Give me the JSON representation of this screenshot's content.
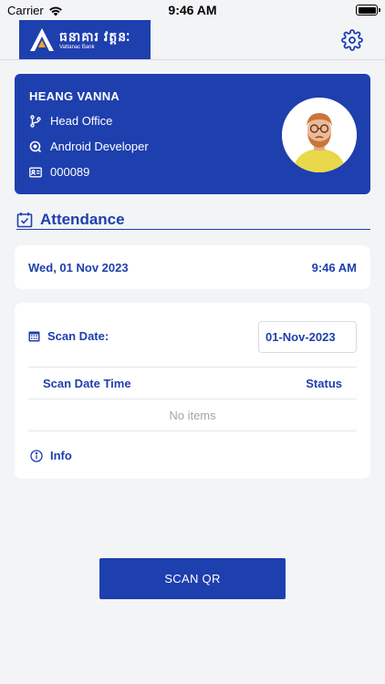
{
  "status_bar": {
    "carrier": "Carrier",
    "time": "9:46 AM"
  },
  "header": {
    "logo_text": "ធនាគារ វត្តនៈ",
    "logo_subtext": "Vattanac Bank",
    "settings_icon": "gear-icon"
  },
  "profile": {
    "name": "HEANG VANNA",
    "branch": "Head Office",
    "position": "Android Developer",
    "employee_id": "000089"
  },
  "attendance": {
    "title": "Attendance",
    "date": "Wed, 01 Nov 2023",
    "time": "9:46 AM"
  },
  "scan": {
    "date_label": "Scan Date:",
    "date_value": "01-Nov-2023",
    "columns": [
      "Scan Date Time",
      "Status"
    ],
    "empty_text": "No items",
    "info_label": "Info",
    "button_label": "SCAN QR"
  },
  "colors": {
    "primary": "#1e3fae",
    "background": "#f3f4f6",
    "muted": "#a0a4ab"
  }
}
